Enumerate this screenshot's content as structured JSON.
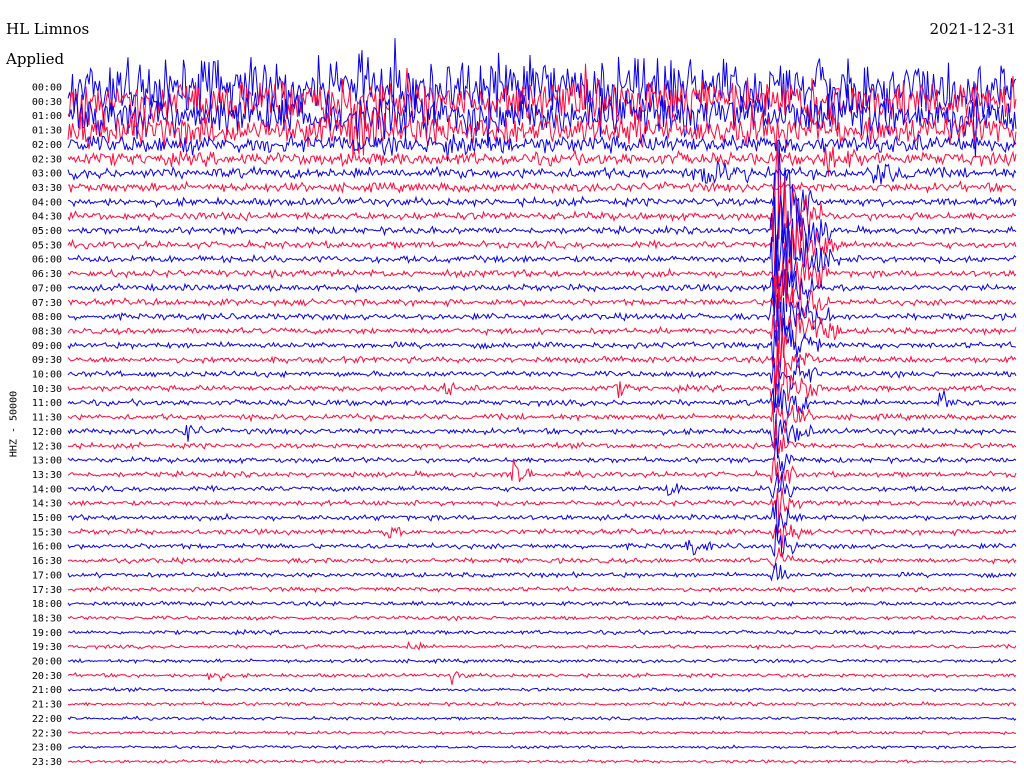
{
  "header": {
    "station": "HL Limnos",
    "filter_status": "Applied",
    "date": "2021-12-31"
  },
  "side_label": "HHZ - 50000",
  "colors": {
    "trace_even": "#0a00e6",
    "trace_odd": "#ff0a3c",
    "background": "#ffffff"
  },
  "chart_data": {
    "type": "helicorder",
    "title": "HL Limnos",
    "date": "2021-12-31",
    "channel": "HHZ",
    "scale": 50000,
    "row_duration_minutes": 30,
    "time_labels": [
      "00:00",
      "00:30",
      "01:00",
      "01:30",
      "02:00",
      "02:30",
      "03:00",
      "03:30",
      "04:00",
      "04:30",
      "05:00",
      "05:30",
      "06:00",
      "06:30",
      "07:00",
      "07:30",
      "08:00",
      "08:30",
      "09:00",
      "09:30",
      "10:00",
      "10:30",
      "11:00",
      "11:30",
      "12:00",
      "12:30",
      "13:00",
      "13:30",
      "14:00",
      "14:30",
      "15:00",
      "15:30",
      "16:00",
      "16:30",
      "17:00",
      "17:30",
      "18:00",
      "18:30",
      "19:00",
      "19:30",
      "20:00",
      "20:30",
      "21:00",
      "21:30",
      "22:00",
      "22:30",
      "23:00",
      "23:30"
    ],
    "noise_level": [
      22,
      18,
      16,
      12,
      7,
      5,
      4,
      3.5,
      3,
      3,
      2.6,
      2.6,
      2.6,
      2.6,
      2.5,
      2.4,
      2.4,
      2.3,
      2.3,
      2.3,
      2.2,
      2.2,
      2.2,
      2.2,
      2.2,
      2,
      2,
      2,
      2,
      2,
      2,
      2,
      2,
      1.9,
      1.8,
      1.7,
      1.6,
      1.5,
      1.5,
      1.4,
      1.4,
      1.4,
      1.3,
      1.3,
      1.2,
      1.2,
      1.1,
      1.1
    ],
    "events": [
      {
        "row": 3,
        "t": 0.3,
        "amp": 14,
        "len": 0.06
      },
      {
        "row": 4,
        "t": 0.4,
        "amp": 10,
        "len": 0.05
      },
      {
        "row": 5,
        "t": 0.8,
        "amp": 10,
        "len": 0.06
      },
      {
        "row": 6,
        "t": 0.67,
        "amp": 10,
        "len": 0.08
      },
      {
        "row": 6,
        "t": 0.85,
        "amp": 10,
        "len": 0.05
      },
      {
        "row": 8,
        "t": 0.745,
        "amp": 90,
        "len": 0.04
      },
      {
        "row": 9,
        "t": 0.745,
        "amp": 60,
        "len": 0.05
      },
      {
        "row": 10,
        "t": 0.745,
        "amp": 55,
        "len": 0.06
      },
      {
        "row": 11,
        "t": 0.745,
        "amp": 55,
        "len": 0.07
      },
      {
        "row": 12,
        "t": 0.745,
        "amp": 50,
        "len": 0.07
      },
      {
        "row": 13,
        "t": 0.745,
        "amp": 50,
        "len": 0.06
      },
      {
        "row": 14,
        "t": 0.745,
        "amp": 45,
        "len": 0.05
      },
      {
        "row": 15,
        "t": 0.745,
        "amp": 40,
        "len": 0.06
      },
      {
        "row": 16,
        "t": 0.745,
        "amp": 45,
        "len": 0.06
      },
      {
        "row": 17,
        "t": 0.745,
        "amp": 40,
        "len": 0.07
      },
      {
        "row": 18,
        "t": 0.745,
        "amp": 40,
        "len": 0.05
      },
      {
        "row": 19,
        "t": 0.745,
        "amp": 30,
        "len": 0.05
      },
      {
        "row": 20,
        "t": 0.745,
        "amp": 30,
        "len": 0.05
      },
      {
        "row": 21,
        "t": 0.745,
        "amp": 35,
        "len": 0.05
      },
      {
        "row": 21,
        "t": 0.395,
        "amp": 10,
        "len": 0.02
      },
      {
        "row": 21,
        "t": 0.578,
        "amp": 7,
        "len": 0.02
      },
      {
        "row": 22,
        "t": 0.745,
        "amp": 30,
        "len": 0.04
      },
      {
        "row": 22,
        "t": 0.92,
        "amp": 9,
        "len": 0.02
      },
      {
        "row": 23,
        "t": 0.745,
        "amp": 25,
        "len": 0.04
      },
      {
        "row": 24,
        "t": 0.745,
        "amp": 25,
        "len": 0.04
      },
      {
        "row": 24,
        "t": 0.125,
        "amp": 10,
        "len": 0.02
      },
      {
        "row": 25,
        "t": 0.745,
        "amp": 20,
        "len": 0.03
      },
      {
        "row": 26,
        "t": 0.745,
        "amp": 20,
        "len": 0.03
      },
      {
        "row": 27,
        "t": 0.745,
        "amp": 18,
        "len": 0.03
      },
      {
        "row": 27,
        "t": 0.47,
        "amp": 12,
        "len": 0.03
      },
      {
        "row": 28,
        "t": 0.745,
        "amp": 20,
        "len": 0.03
      },
      {
        "row": 28,
        "t": 0.63,
        "amp": 10,
        "len": 0.02
      },
      {
        "row": 29,
        "t": 0.745,
        "amp": 18,
        "len": 0.03
      },
      {
        "row": 30,
        "t": 0.745,
        "amp": 18,
        "len": 0.03
      },
      {
        "row": 31,
        "t": 0.745,
        "amp": 18,
        "len": 0.03
      },
      {
        "row": 31,
        "t": 0.335,
        "amp": 8,
        "len": 0.02
      },
      {
        "row": 32,
        "t": 0.745,
        "amp": 18,
        "len": 0.03
      },
      {
        "row": 32,
        "t": 0.655,
        "amp": 8,
        "len": 0.03
      },
      {
        "row": 33,
        "t": 0.745,
        "amp": 15,
        "len": 0.02
      },
      {
        "row": 34,
        "t": 0.745,
        "amp": 15,
        "len": 0.02
      },
      {
        "row": 39,
        "t": 0.36,
        "amp": 5,
        "len": 0.02
      },
      {
        "row": 41,
        "t": 0.15,
        "amp": 7,
        "len": 0.02
      },
      {
        "row": 41,
        "t": 0.405,
        "amp": 5,
        "len": 0.02
      }
    ]
  }
}
